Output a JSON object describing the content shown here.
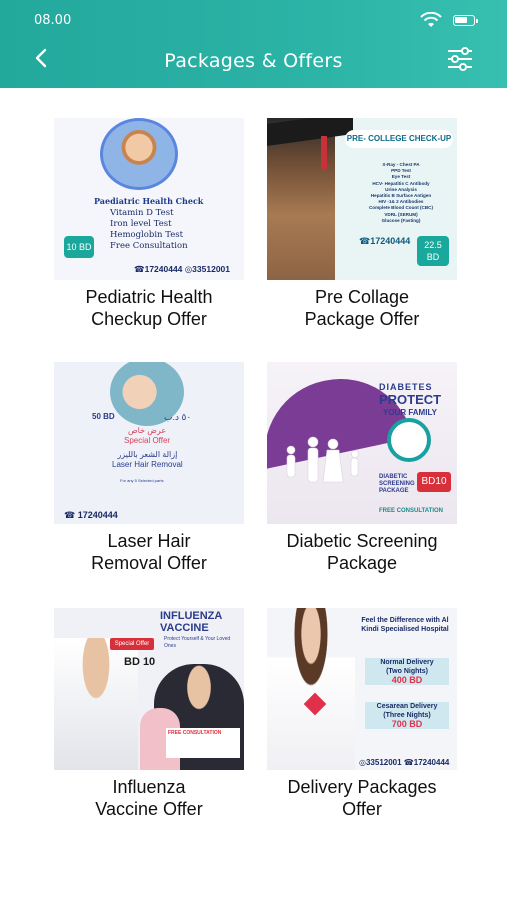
{
  "status_bar": {
    "time": "08.00"
  },
  "header": {
    "title": "Packages & Offers"
  },
  "colors": {
    "header_start": "#23a89c",
    "header_end": "#37bfb0",
    "accent": "#1aa89c"
  },
  "packages": [
    {
      "title_line1": "Pediatric Health",
      "title_line2": "Checkup Offer",
      "image": {
        "heading": "Paediatric Health Check",
        "items": [
          "Vitamin D Test",
          "Iron level Test",
          "Hemoglobin Test",
          "Free Consultation"
        ],
        "price": "10 BD",
        "phones": "☎17240444 ◎33512001"
      }
    },
    {
      "title_line1": "Pre Collage",
      "title_line2": "Package Offer",
      "image": {
        "heading": "PRE- COLLEGE CHECK-UP",
        "items": [
          "X-Ray - Chest PA",
          "PPD Test",
          "Eye Test",
          "HCV- Hepatitis C Antibody",
          "Urine Analysis",
          "Hepatitis B Surface Antigen",
          "HIV -1& 2 Antibodies",
          "Complete Blood Count (CBC)",
          "VDRL (SERUM)",
          "Glucose (Fasting)"
        ],
        "phones": "☎17240444",
        "price_value": "22.5",
        "price_unit": "BD"
      }
    },
    {
      "title_line1": "Laser Hair",
      "title_line2": "Removal Offer",
      "image": {
        "price": "50 BD",
        "arabic_price": "٥٠ د.ب",
        "special_ar": "عرض خاص",
        "special_en": "Special Offer",
        "service_ar": "إزالة الشعر بالليزر",
        "service_en": "Laser Hair Removal",
        "note": "For any 5 Selected parts",
        "phones": "☎ 17240444"
      }
    },
    {
      "title_line1": "Diabetic Screening",
      "title_line2": "Package",
      "image": {
        "line1": "DIABETES",
        "line2": "PROTECT",
        "line3": "YOUR FAMILY",
        "package": "DIABETIC SCREENING PACKAGE",
        "price": "BD10",
        "footer": "FREE CONSULTATION"
      }
    },
    {
      "title_line1": "Influenza",
      "title_line2": "Vaccine Offer",
      "image": {
        "line1": "INFLUENZA",
        "line2": "VACCINE",
        "tagline": "Protect Yourself & Your Loved Ones",
        "special": "Special Offer",
        "price": "BD 10",
        "footer": "FREE CONSULTATION"
      }
    },
    {
      "title_line1": "Delivery Packages",
      "title_line2": "Offer",
      "image": {
        "heading": "Feel the Difference with Al Kindi Specialised Hospital",
        "normal_title": "Normal Delivery",
        "normal_sub": "(Two Nights)",
        "normal_price": "400 BD",
        "cesarean_title": "Cesarean Delivery",
        "cesarean_sub": "(Three Nights)",
        "cesarean_price": "700 BD",
        "phones": "◎33512001 ☎17240444"
      }
    }
  ]
}
